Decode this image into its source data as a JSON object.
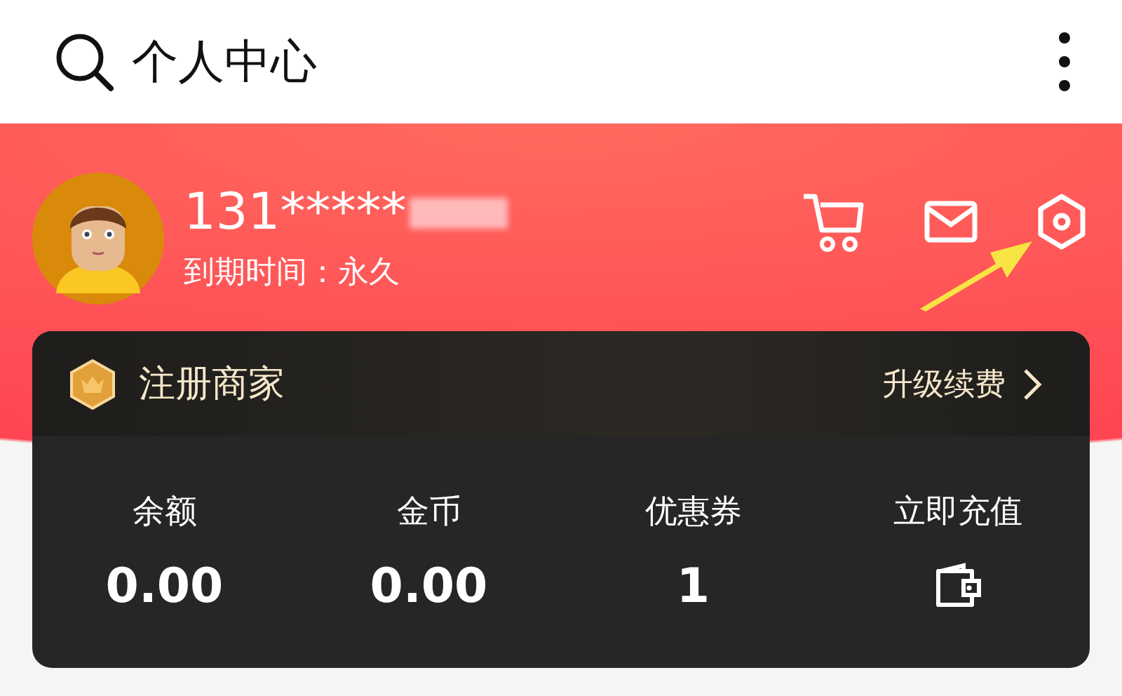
{
  "header": {
    "title": "个人中心"
  },
  "profile": {
    "phone": "131*****",
    "expiry": "到期时间：永久"
  },
  "membership": {
    "title": "注册商家",
    "action": "升级续费"
  },
  "stats": [
    {
      "kind": "value",
      "label": "余额",
      "value": "0.00"
    },
    {
      "kind": "value",
      "label": "金币",
      "value": "0.00"
    },
    {
      "kind": "value",
      "label": "优惠券",
      "value": "1"
    },
    {
      "kind": "wallet",
      "label": "立即充值"
    }
  ]
}
